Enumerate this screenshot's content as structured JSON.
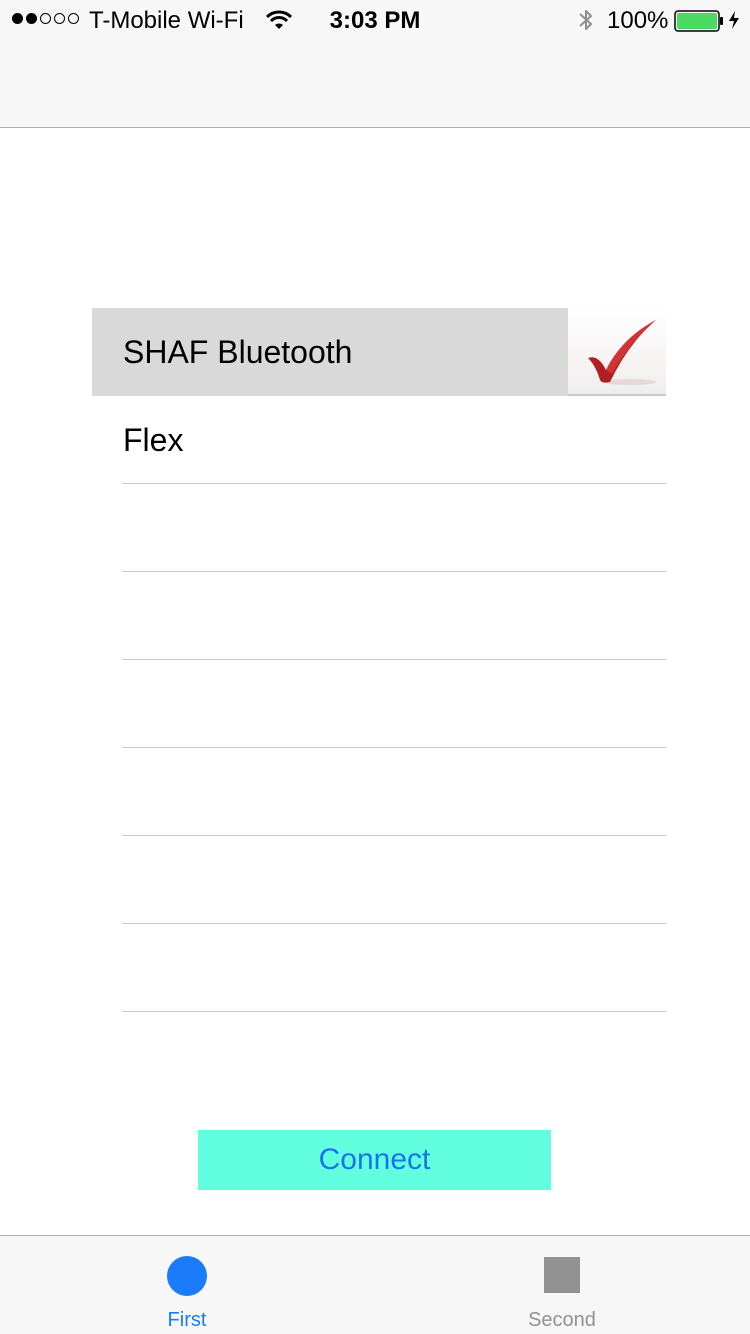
{
  "status_bar": {
    "signal_bars_filled": 2,
    "signal_bars_total": 5,
    "carrier": "T-Mobile Wi-Fi",
    "time": "3:03 PM",
    "battery_percent": "100%",
    "battery_level": 1.0,
    "icons": [
      "wifi-icon",
      "bluetooth-icon",
      "battery-icon",
      "charging-icon"
    ]
  },
  "devices": {
    "selected_index": 0,
    "items": [
      {
        "label": "SHAF Bluetooth",
        "selected": true
      },
      {
        "label": "Flex",
        "selected": false
      },
      {
        "label": "",
        "selected": false
      },
      {
        "label": "",
        "selected": false
      },
      {
        "label": "",
        "selected": false
      },
      {
        "label": "",
        "selected": false
      },
      {
        "label": "",
        "selected": false
      },
      {
        "label": "",
        "selected": false
      }
    ]
  },
  "connect_button": {
    "label": "Connect"
  },
  "tab_bar": {
    "tabs": [
      {
        "label": "First",
        "icon": "circle-icon",
        "active": true
      },
      {
        "label": "Second",
        "icon": "square-icon",
        "active": false
      }
    ]
  },
  "colors": {
    "accent": "#1a7cf9",
    "button_bg": "#61ffe0",
    "selected_row": "#d9d9d9",
    "checkmark": "#b01e22",
    "battery_fill": "#4cd964"
  }
}
